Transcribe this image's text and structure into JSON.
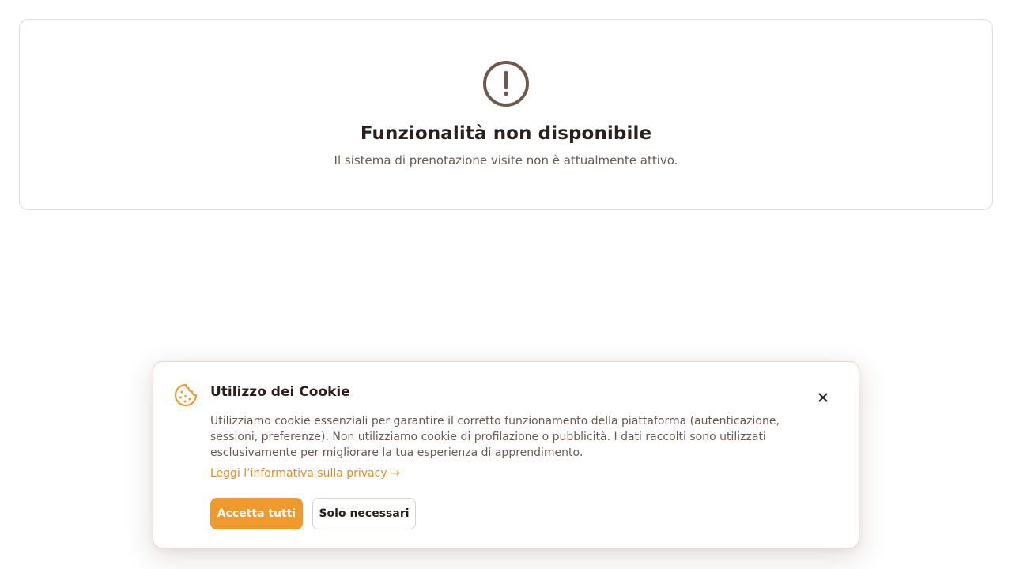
{
  "notice": {
    "icon": "alert-circle-icon",
    "title": "Funzionalità non disponibile",
    "message": "Il sistema di prenotazione visite non è attualmente attivo.",
    "icon_color": "#6e5a4c"
  },
  "cookie_banner": {
    "icon": "cookie-icon",
    "title": "Utilizzo dei Cookie",
    "description": "Utilizziamo cookie essenziali per garantire il corretto funzionamento della piattaforma (autenticazione, sessioni, preferenze). Non utilizziamo cookie di profilazione o pubblicità. I dati raccolti sono utilizzati esclusivamente per migliorare la tua esperienza di apprendimento.",
    "privacy_link": "Leggi l’informativa sulla privacy →",
    "accept_label": "Accetta tutti",
    "necessary_label": "Solo necessari",
    "close_icon": "close-icon",
    "accent_color": "#f09a2d"
  }
}
